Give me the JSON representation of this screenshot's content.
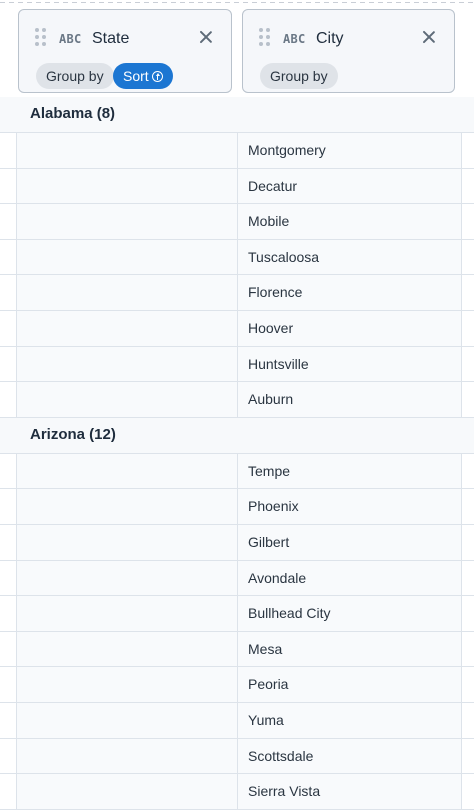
{
  "columns": [
    {
      "type_icon": "ABC",
      "name": "State",
      "group_label": "Group by",
      "sort_label": "Sort"
    },
    {
      "type_icon": "ABC",
      "name": "City",
      "group_label": "Group by"
    }
  ],
  "groups": [
    {
      "label": "Alabama (8)",
      "cities": [
        "Montgomery",
        "Decatur",
        "Mobile",
        "Tuscaloosa",
        "Florence",
        "Hoover",
        "Huntsville",
        "Auburn"
      ]
    },
    {
      "label": "Arizona (12)",
      "cities": [
        "Tempe",
        "Phoenix",
        "Gilbert",
        "Avondale",
        "Bullhead City",
        "Mesa",
        "Peoria",
        "Yuma",
        "Scottsdale",
        "Sierra Vista"
      ]
    }
  ]
}
